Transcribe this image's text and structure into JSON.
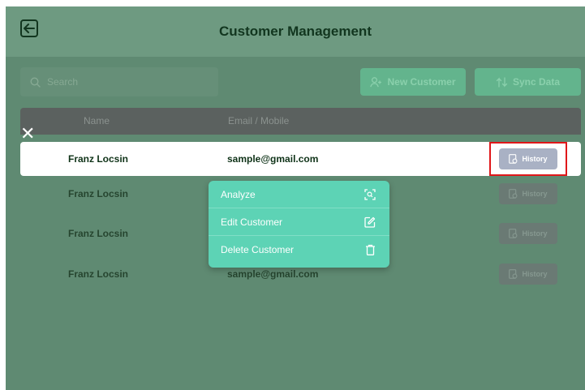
{
  "header": {
    "title": "Customer Management"
  },
  "toolbar": {
    "search_placeholder": "Search",
    "new_customer_label": "New Customer",
    "sync_label": "Sync Data"
  },
  "table": {
    "columns": [
      "Name",
      "Email / Mobile"
    ],
    "rows": [
      {
        "name": "Franz Locsin",
        "email": "sample@gmail.com",
        "history_label": "History"
      },
      {
        "name": "Franz Locsin",
        "email": "",
        "history_label": "History"
      },
      {
        "name": "Franz Locsin",
        "email": "",
        "history_label": "History"
      },
      {
        "name": "Franz Locsin",
        "email": "sample@gmail.com",
        "history_label": "History"
      }
    ]
  },
  "context_menu": {
    "items": [
      "Analyze",
      "Edit Customer",
      "Delete Customer"
    ]
  },
  "icons": [
    "back-arrow-icon",
    "search-icon",
    "add-user-icon",
    "sync-icon",
    "close-icon",
    "history-icon",
    "scan-icon",
    "edit-icon",
    "trash-icon"
  ],
  "colors": {
    "highlight": "#e0171a",
    "menu": "#5dd3b5",
    "button": "#63b48d"
  }
}
